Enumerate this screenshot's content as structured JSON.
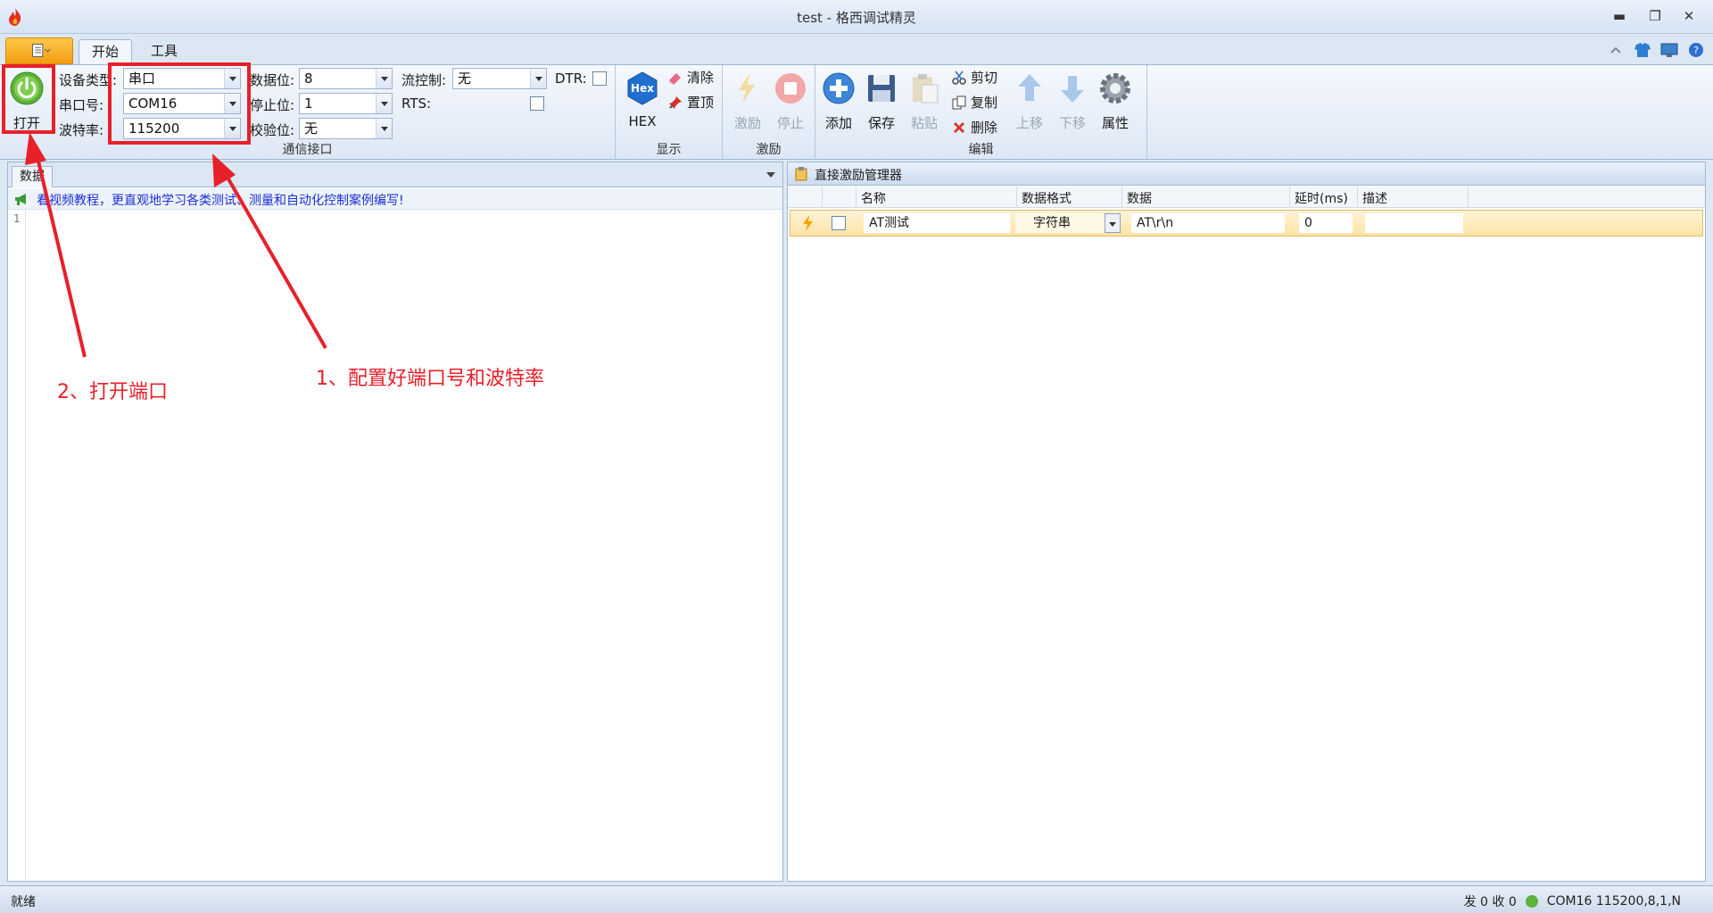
{
  "window": {
    "title": "test - 格西调试精灵",
    "controls": [
      "minimize-icon",
      "restore-icon",
      "close-icon"
    ]
  },
  "ribbon_tabs": [
    {
      "label": "开始",
      "active": true
    },
    {
      "label": "工具",
      "active": false
    }
  ],
  "comm_group": {
    "label": "通信接口",
    "open_button": "打开",
    "device_type": {
      "label": "设备类型:",
      "value": "串口"
    },
    "port": {
      "label": "串口号:",
      "value": "COM16"
    },
    "baud": {
      "label": "波特率:",
      "value": "115200"
    },
    "data_bits": {
      "label": "数据位:",
      "value": "8"
    },
    "stop_bits": {
      "label": "停止位:",
      "value": "1"
    },
    "parity": {
      "label": "校验位:",
      "value": "无"
    },
    "flow": {
      "label": "流控制:",
      "value": "无"
    },
    "dtr": {
      "label": "DTR:"
    },
    "rts": {
      "label": "RTS:"
    }
  },
  "display_group": {
    "label": "显示",
    "hex": "HEX",
    "hex_icon_text": "Hex",
    "clear": "清除",
    "top": "置顶"
  },
  "stim_group": {
    "label": "激励",
    "stimulate": "激励",
    "stop": "停止"
  },
  "edit_group": {
    "label": "编辑",
    "add": "添加",
    "save": "保存",
    "paste": "粘贴",
    "cut": "剪切",
    "copy": "复制",
    "delete": "删除",
    "up": "上移",
    "down": "下移",
    "props": "属性"
  },
  "left_panel": {
    "tab": "数据",
    "promo": "看视频教程，更直观地学习各类测试、测量和自动化控制案例编写!",
    "line_number": "1"
  },
  "right_panel": {
    "title": "直接激励管理器",
    "columns": [
      "名称",
      "数据格式",
      "数据",
      "延时(ms)",
      "描述"
    ],
    "rows": [
      {
        "name": "AT测试",
        "format": "字符串",
        "data": "AT\\r\\n",
        "delay": "0",
        "desc": ""
      }
    ]
  },
  "status": {
    "left": "就绪",
    "right": "发 0  收 0",
    "port_info": "COM16 115200,8,1,N"
  },
  "annotations": {
    "step1": "1、配置好端口号和波特率",
    "step2": "2、打开端口",
    "color": "#e8202a"
  }
}
